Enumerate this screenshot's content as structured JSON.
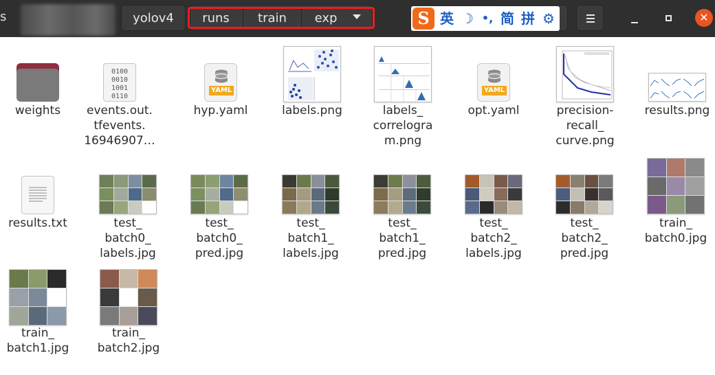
{
  "header": {
    "left_edge_glyph": "s",
    "breadcrumbs": [
      "yolov4",
      "runs",
      "train",
      "exp"
    ],
    "ime": {
      "logo": "S",
      "items": [
        "英",
        "☽",
        "•,",
        "简",
        "拼",
        "⚙"
      ]
    },
    "close_glyph": "✕"
  },
  "files": [
    {
      "name": "weights",
      "type": "folder"
    },
    {
      "name": "events.out.\ntfevents.\n16946907…",
      "type": "binary"
    },
    {
      "name": "hyp.yaml",
      "type": "yaml"
    },
    {
      "name": "labels.png",
      "type": "image"
    },
    {
      "name": "labels_\ncorrelogra\nm.png",
      "type": "image"
    },
    {
      "name": "opt.yaml",
      "type": "yaml"
    },
    {
      "name": "precision-\nrecall_\ncurve.png",
      "type": "image"
    },
    {
      "name": "results.png",
      "type": "image"
    },
    {
      "name": "results.txt",
      "type": "text"
    },
    {
      "name": "test_\nbatch0_\nlabels.jpg",
      "type": "image"
    },
    {
      "name": "test_\nbatch0_\npred.jpg",
      "type": "image"
    },
    {
      "name": "test_\nbatch1_\nlabels.jpg",
      "type": "image"
    },
    {
      "name": "test_\nbatch1_\npred.jpg",
      "type": "image"
    },
    {
      "name": "test_\nbatch2_\nlabels.jpg",
      "type": "image"
    },
    {
      "name": "test_\nbatch2_\npred.jpg",
      "type": "image"
    },
    {
      "name": "train_\nbatch0.jpg",
      "type": "image"
    },
    {
      "name": "train_\nbatch1.jpg",
      "type": "image"
    },
    {
      "name": "train_\nbatch2.jpg",
      "type": "image"
    }
  ],
  "binary_icon_text": [
    "0100",
    "0010",
    "1001",
    "0110"
  ],
  "yaml_label": "YAML",
  "colors": {
    "headerbar": "#2f2f2f",
    "highlight": "#e8201c",
    "close": "#e95420",
    "ime_text": "#1b5fc1",
    "folder": "#7a7a7a",
    "folder_tab": "#8e2e3f"
  }
}
